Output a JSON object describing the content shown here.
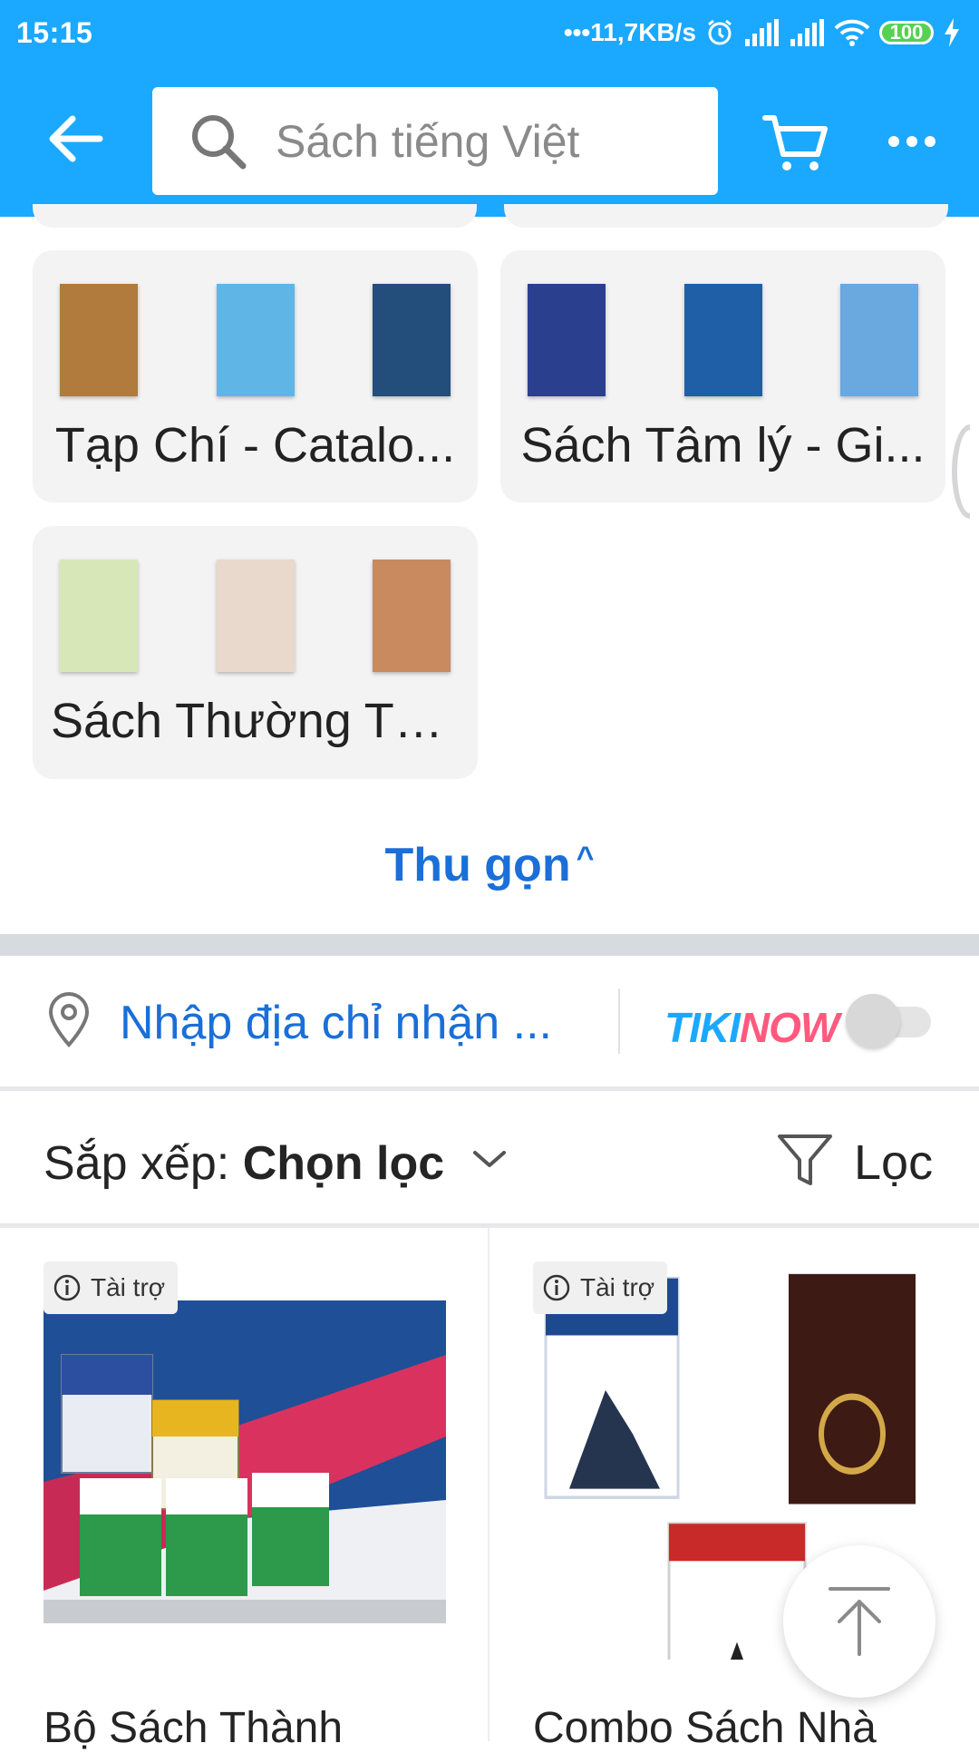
{
  "status_bar": {
    "time": "15:15",
    "network_speed": "11,7KB/s",
    "battery": "100",
    "icons": [
      "alarm-icon",
      "signal-icon",
      "signal-icon",
      "wifi-icon",
      "battery-icon",
      "charging-icon"
    ]
  },
  "header": {
    "back_icon": "arrow-left-icon",
    "search_placeholder": "Sách tiếng Việt",
    "search_icon": "search-icon",
    "cart_icon": "cart-icon",
    "more_icon": "more-horizontal-icon"
  },
  "categories": [
    {
      "label": "Tạp Chí - Catalo...",
      "cover_colors": [
        "#b07b3c",
        "#5fb6e6",
        "#234d7a"
      ]
    },
    {
      "label": "Sách Tâm lý - Gi...",
      "cover_colors": [
        "#2b3f8f",
        "#1e5fa8",
        "#6aa8e0"
      ]
    },
    {
      "label": "Sách Thường Th...",
      "cover_colors": [
        "#d8e7b8",
        "#e8d9cc",
        "#c98a5f"
      ]
    }
  ],
  "collapse_label": "Thu gọn",
  "address": {
    "placeholder": "Nhập địa chỉ nhận ...",
    "tikinow_brand_a": "TIKI",
    "tikinow_brand_b": "NOW",
    "toggle_on": false
  },
  "sort": {
    "prefix": "Sắp xếp: ",
    "value": "Chọn lọc",
    "filter_label": "Lọc"
  },
  "products": [
    {
      "badge": "Tài trợ",
      "title": "Bộ Sách Thành"
    },
    {
      "badge": "Tài trợ",
      "title": "Combo Sách Nhà"
    }
  ],
  "colors": {
    "primary": "#1ba8ff",
    "link_blue": "#1a6fd8",
    "tile_bg": "#f3f3f4",
    "separator": "#d7dade"
  }
}
